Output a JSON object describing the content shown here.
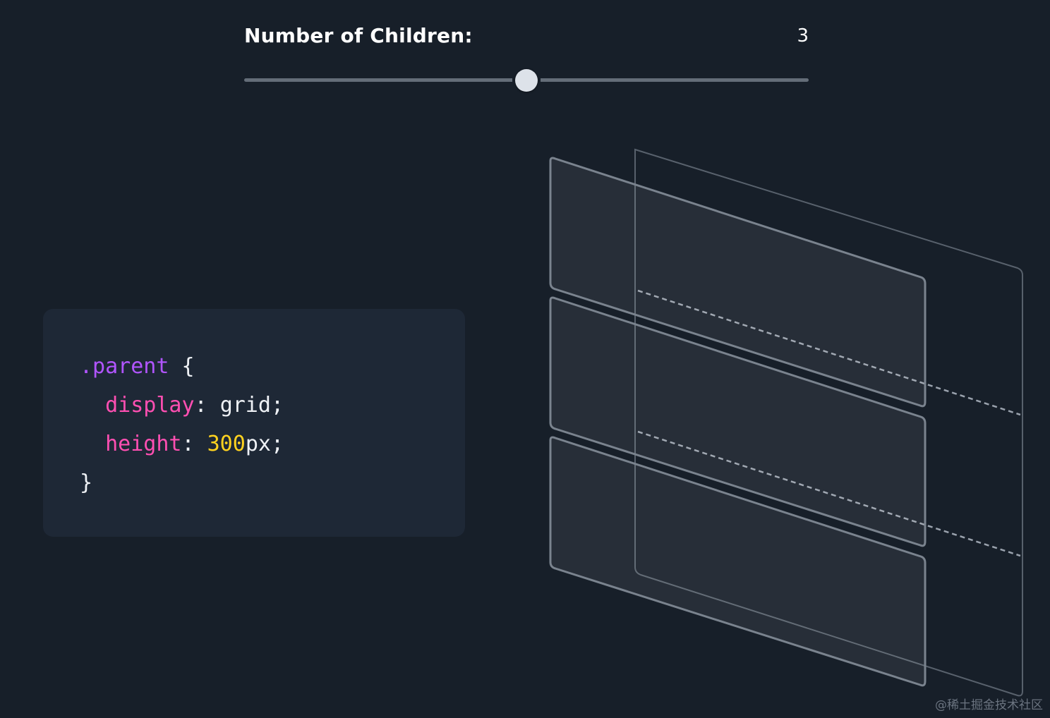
{
  "control": {
    "label": "Number of Children:",
    "value": "3",
    "slider_fraction": 0.5
  },
  "code": {
    "selector": ".parent",
    "open_brace": "{",
    "declarations": [
      {
        "property": "display",
        "value_number": "",
        "value_rest": "grid"
      },
      {
        "property": "height",
        "value_number": "300",
        "value_rest": "px"
      }
    ],
    "close_brace": "}"
  },
  "diagram": {
    "children_count": 3
  },
  "watermark": "@稀土掘金技术社区",
  "colors": {
    "background": "#171f29",
    "panel": "#1e2836",
    "selector": "#b155ff",
    "property": "#ff4fb2",
    "number": "#ffd21f",
    "slider_track": "#646d78",
    "slider_thumb": "#dde2e9"
  }
}
